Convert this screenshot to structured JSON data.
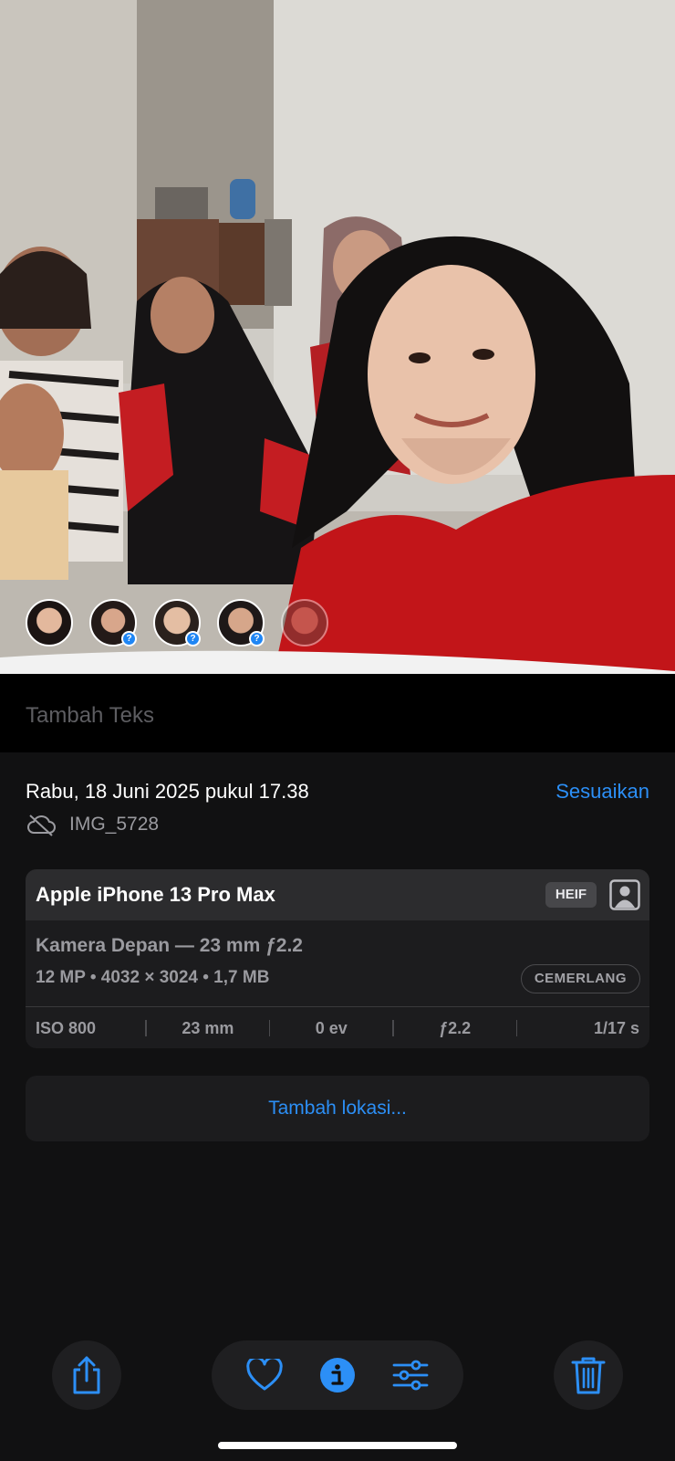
{
  "photo": {
    "face_tags": [
      {
        "id": "face-1",
        "unconfirmed": false
      },
      {
        "id": "face-2",
        "unconfirmed": true
      },
      {
        "id": "face-3",
        "unconfirmed": true
      },
      {
        "id": "face-4",
        "unconfirmed": true
      },
      {
        "id": "face-5",
        "unconfirmed": false
      }
    ],
    "unconfirmed_badge": "?"
  },
  "caption": {
    "placeholder": "Tambah Teks"
  },
  "info": {
    "date": "Rabu, 18 Juni 2025 pukul 17.38",
    "adjust_label": "Sesuaikan",
    "filename": "IMG_5728",
    "cloud_icon": "cloud-slash-icon"
  },
  "camera": {
    "device": "Apple iPhone 13 Pro Max",
    "format_badge": "HEIF",
    "lens": "Kamera Depan — 23 mm ƒ2.2",
    "specs": "12 MP  •  4032 × 3024  •  1,7 MB",
    "style": "CEMERLANG",
    "exif": {
      "iso": "ISO 800",
      "focal": "23 mm",
      "ev": "0 ev",
      "aperture": "ƒ2.2",
      "shutter": "1/17 s"
    }
  },
  "location": {
    "label": "Tambah lokasi..."
  },
  "toolbar": {
    "share_icon": "share-icon",
    "favorite_icon": "heart-icon",
    "info_icon": "info-icon",
    "edit_icon": "adjust-sliders-icon",
    "delete_icon": "trash-icon"
  },
  "colors": {
    "accent": "#2c8ff6",
    "background": "#111112",
    "card": "#1c1c1e"
  }
}
